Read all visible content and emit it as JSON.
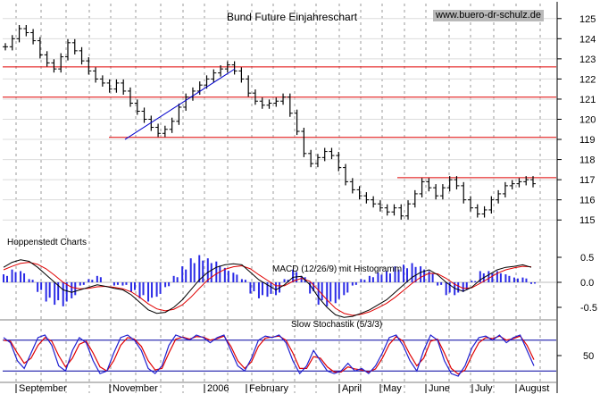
{
  "title": "Bund Future Einjahreschart",
  "watermark": "www.buero-dr-schulz.de",
  "source_label": "Hoppenstedt Charts",
  "colors": {
    "grid": "#9a9a9a",
    "resistance": "#e00000",
    "trend": "#0000cc",
    "price": "#000000",
    "macd_hist": "#2a2ae6",
    "macd": "#000000",
    "signal": "#e00000",
    "stoch_k": "#2020d0",
    "stoch_d": "#e00000",
    "stoch_level": "#0000a0"
  },
  "chart_data": [
    {
      "type": "line",
      "name": "price-panel",
      "x_labels": [
        "September",
        "November",
        "2006",
        "February",
        "April",
        "May",
        "June",
        "July",
        "August"
      ],
      "y_ticks": [
        115,
        116,
        117,
        118,
        119,
        120,
        121,
        122,
        123,
        124,
        125
      ],
      "ylim": [
        114.3,
        125.7
      ],
      "closes": [
        123.6,
        124.0,
        124.5,
        124.3,
        123.9,
        123.2,
        122.8,
        122.5,
        123.1,
        123.8,
        123.4,
        122.9,
        122.4,
        122.0,
        121.8,
        121.5,
        121.8,
        121.4,
        120.8,
        120.4,
        120.0,
        119.6,
        119.3,
        119.5,
        119.9,
        120.6,
        121.1,
        121.4,
        121.7,
        122.0,
        122.3,
        122.5,
        122.7,
        122.4,
        122.0,
        121.3,
        120.9,
        120.7,
        120.8,
        120.9,
        121.1,
        120.3,
        119.4,
        118.3,
        117.8,
        118.1,
        118.4,
        118.2,
        117.6,
        116.9,
        116.5,
        116.2,
        116.0,
        115.8,
        115.6,
        115.4,
        115.6,
        115.2,
        115.8,
        116.3,
        116.9,
        116.6,
        116.2,
        116.6,
        117.0,
        116.7,
        116.0,
        115.6,
        115.3,
        115.5,
        116.0,
        116.3,
        116.7,
        116.8,
        116.9,
        117.0,
        116.8
      ],
      "resistance_levels": [
        122.6,
        121.1,
        119.1,
        117.1
      ],
      "trendline": {
        "from": 119.0,
        "to": 122.5
      }
    },
    {
      "type": "bar",
      "name": "MACD (12/26/9) mit Histogramm",
      "label": "MACD (12/26/9) mit Histogramm",
      "y_ticks": [
        "0.5",
        "0.0",
        "-0.5"
      ],
      "ylim": [
        -0.85,
        0.85
      ],
      "macd": [
        0.3,
        0.4,
        0.45,
        0.42,
        0.3,
        0.15,
        0.0,
        -0.15,
        -0.2,
        -0.15,
        -0.1,
        -0.05,
        -0.08,
        -0.12,
        -0.15,
        -0.25,
        -0.4,
        -0.55,
        -0.62,
        -0.6,
        -0.5,
        -0.35,
        -0.15,
        0.05,
        0.2,
        0.3,
        0.35,
        0.37,
        0.35,
        0.2,
        0.05,
        -0.05,
        -0.15,
        -0.05,
        0.1,
        0.12,
        -0.05,
        -0.3,
        -0.5,
        -0.65,
        -0.7,
        -0.68,
        -0.62,
        -0.55,
        -0.45,
        -0.35,
        -0.2,
        -0.05,
        0.1,
        0.2,
        0.25,
        0.15,
        0.0,
        -0.12,
        -0.18,
        -0.1,
        0.05,
        0.15,
        0.25,
        0.3,
        0.32,
        0.35,
        0.3
      ],
      "signal": [
        0.25,
        0.32,
        0.38,
        0.4,
        0.36,
        0.27,
        0.14,
        0.0,
        -0.1,
        -0.13,
        -0.12,
        -0.09,
        -0.08,
        -0.1,
        -0.13,
        -0.19,
        -0.3,
        -0.43,
        -0.53,
        -0.57,
        -0.54,
        -0.45,
        -0.3,
        -0.12,
        0.05,
        0.17,
        0.26,
        0.31,
        0.33,
        0.27,
        0.15,
        0.04,
        -0.07,
        -0.07,
        0.02,
        0.08,
        0.02,
        -0.16,
        -0.35,
        -0.52,
        -0.62,
        -0.66,
        -0.64,
        -0.59,
        -0.51,
        -0.42,
        -0.3,
        -0.16,
        -0.02,
        0.1,
        0.18,
        0.17,
        0.08,
        -0.04,
        -0.12,
        -0.11,
        -0.02,
        0.08,
        0.18,
        0.25,
        0.29,
        0.32,
        0.31
      ]
    },
    {
      "type": "line",
      "name": "Slow Stochastik (5/3/3)",
      "label": "Slow Stochastik (5/3/3)",
      "y_ticks": [
        "50"
      ],
      "ylim": [
        0,
        100
      ],
      "levels": [
        80,
        20
      ],
      "k": [
        85,
        75,
        40,
        25,
        55,
        85,
        90,
        70,
        30,
        20,
        60,
        85,
        75,
        40,
        15,
        20,
        55,
        85,
        90,
        80,
        60,
        25,
        15,
        30,
        70,
        90,
        85,
        80,
        90,
        85,
        75,
        85,
        90,
        60,
        30,
        20,
        45,
        80,
        88,
        85,
        90,
        75,
        40,
        15,
        30,
        60,
        40,
        20,
        15,
        20,
        35,
        20,
        25,
        15,
        30,
        55,
        85,
        90,
        70,
        40,
        20,
        60,
        90,
        80,
        40,
        15,
        10,
        30,
        65,
        85,
        88,
        80,
        90,
        75,
        85,
        90,
        60,
        30
      ],
      "d": [
        80,
        78,
        55,
        35,
        45,
        70,
        85,
        78,
        50,
        28,
        45,
        72,
        78,
        55,
        28,
        20,
        40,
        70,
        85,
        82,
        68,
        40,
        22,
        25,
        55,
        82,
        86,
        82,
        87,
        86,
        80,
        83,
        88,
        68,
        40,
        25,
        38,
        68,
        84,
        86,
        88,
        80,
        55,
        25,
        25,
        48,
        45,
        28,
        18,
        18,
        28,
        24,
        22,
        18,
        24,
        45,
        72,
        87,
        78,
        52,
        30,
        45,
        78,
        82,
        55,
        25,
        14,
        22,
        50,
        75,
        85,
        83,
        88,
        80,
        83,
        88,
        70,
        42
      ]
    }
  ]
}
